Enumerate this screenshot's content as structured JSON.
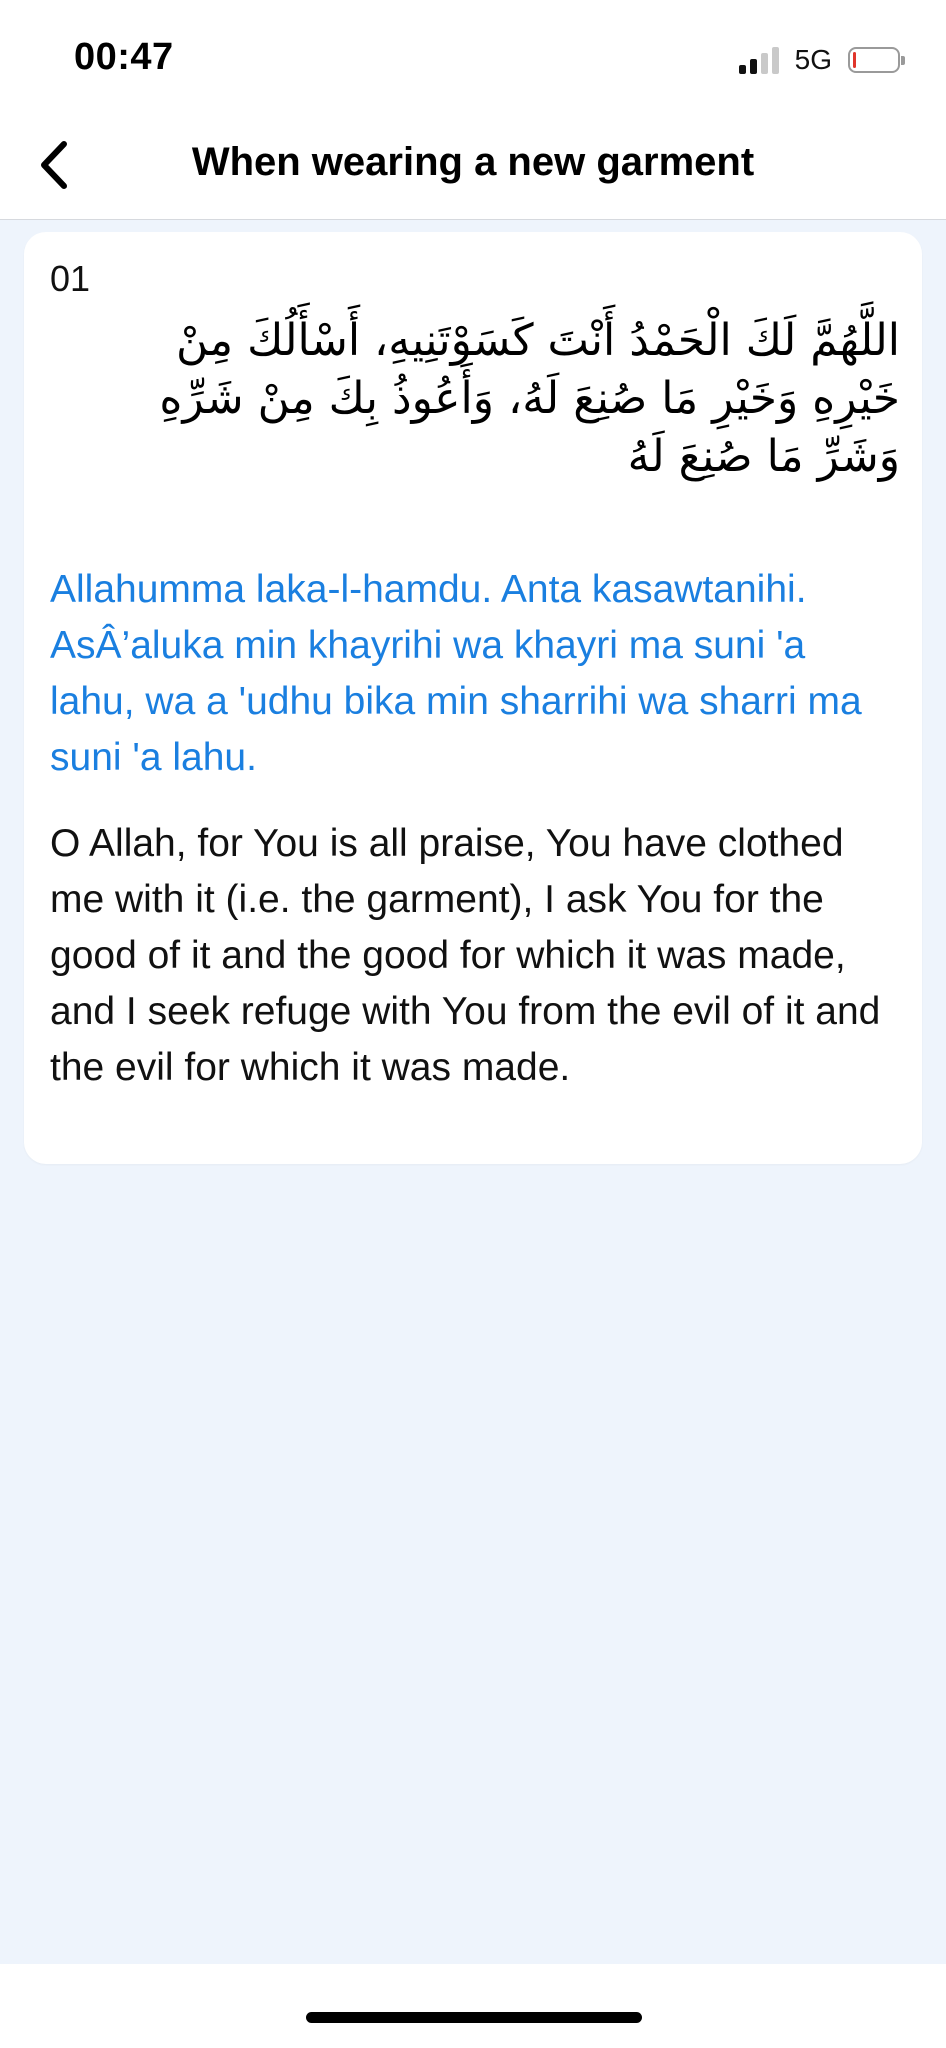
{
  "status_bar": {
    "time": "00:47",
    "network": "5G",
    "signal_bars_active": 2,
    "signal_bars_total": 4,
    "battery_level": 0.05,
    "battery_color": "#e0352b"
  },
  "nav": {
    "back_icon": "chevron-left-icon",
    "title": "When wearing a new garment"
  },
  "dua": {
    "number": "01",
    "arabic": "اللَّهُمَّ لَكَ الْحَمْدُ أَنْتَ كَسَوْتَنِيهِ، أَسْأَلُكَ مِنْ خَيْرِهِ وَخَيْرِ مَا صُنِعَ لَهُ، وَأَعُوذُ بِكَ مِنْ شَرِّهِ وَشَرِّ مَا صُنِعَ لَهُ",
    "transliteration": "Allahumma laka-l-hamdu. Anta kasawtanihi. AsÂ’aluka min khayrihi wa khayri ma suni 'a lahu, wa a 'udhu bika min sharrihi wa sharri ma suni 'a lahu.",
    "translation": "O Allah, for You is all praise, You have clothed me with it (i.e. the garment), I ask You for the good of it and the good for which it was made, and I seek refuge with You from the evil of it and the evil for which it was made."
  },
  "colors": {
    "accent": "#1a7fe0",
    "background": "#eef4fc",
    "card": "#ffffff"
  }
}
